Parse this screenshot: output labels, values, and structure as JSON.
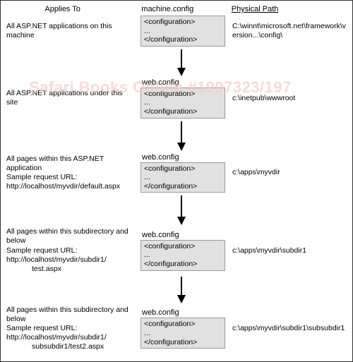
{
  "headers": {
    "applies": "Applies To",
    "file_machine": "machine.config",
    "path": "Physical Path"
  },
  "file_web": "web.config",
  "code_snippet": "<configuration>\n...\n</configuration>",
  "watermark": "Safari Books Online #1997323/197",
  "levels": [
    {
      "applies": "All ASP.NET applications on this machine",
      "show_file_label": false,
      "path": "C:\\winnt\\microsoft.net\\framework\\version...\\config\\"
    },
    {
      "applies": "All ASP.NET applications under this site",
      "show_file_label": true,
      "path": "c:\\inetpub\\wwwroot"
    },
    {
      "applies": "All pages within this ASP.NET application\nSample request URL:\nhttp://localhost/myvdir/default.aspx",
      "show_file_label": true,
      "path": "c:\\apps\\myvdir"
    },
    {
      "applies": "All pages within this subdirectory and below\nSample request URL:\nhttp://localhost/myvdir/subdir1/",
      "applies_indent": "test.aspx",
      "show_file_label": true,
      "path": "c:\\apps\\myvdir\\subdir1"
    },
    {
      "applies": "All pages within this subdirectory and below\nSample request URL:\nhttp://localhost/myvdir/subdir1/",
      "applies_indent": "subsubdir1/test2.aspx",
      "show_file_label": true,
      "path": "c:\\apps\\myvdir\\subdir1\\subsubdir1"
    }
  ]
}
